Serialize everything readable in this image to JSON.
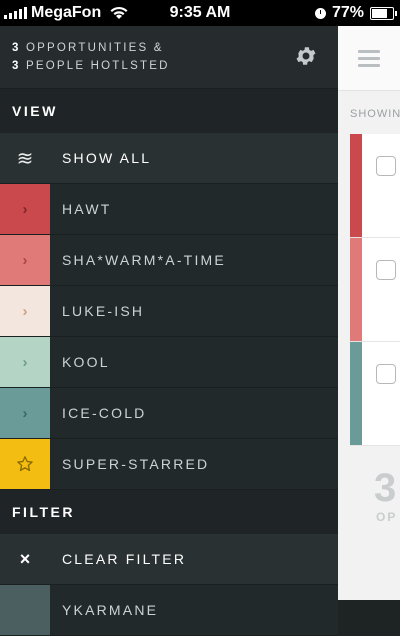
{
  "status_bar": {
    "carrier": "MegaFon",
    "time": "9:35 AM",
    "battery": "77%"
  },
  "sidebar": {
    "summary": {
      "opportunities_count": "3",
      "opportunities_label": "OPPORTUNITIES &",
      "people_count": "3",
      "people_label": "PEOPLE HOTLSTED"
    },
    "view_header": "VIEW",
    "show_all_label": "SHOW ALL",
    "view_items": [
      {
        "label": "HAWT",
        "color": "#c9494c",
        "chevron_color": "#7e2628",
        "icon": "chevron-right-icon"
      },
      {
        "label": "SHA*WARM*A-TIME",
        "color": "#e07a78",
        "chevron_color": "#a64745",
        "icon": "chevron-right-icon"
      },
      {
        "label": "LUKE-ISH",
        "color": "#f3e6de",
        "chevron_color": "#d0a07e",
        "icon": "chevron-right-icon"
      },
      {
        "label": "KOOL",
        "color": "#b4d5c6",
        "chevron_color": "#6f9c88",
        "icon": "chevron-right-icon"
      },
      {
        "label": "ICE-COLD",
        "color": "#6a9b98",
        "chevron_color": "#3f6765",
        "icon": "chevron-right-icon"
      },
      {
        "label": "SUPER-STARRED",
        "color": "#f3be11",
        "chevron_color": "#8a6a00",
        "icon": "star-icon"
      }
    ],
    "filter_header": "FILTER",
    "clear_filter_label": "CLEAR FILTER",
    "partial_item_label": "YKARMANE",
    "partial_item_color": "#4b5f61"
  },
  "main": {
    "showing_label": "SHOWIN",
    "card_colors": [
      "#c9494c",
      "#e07a78",
      "#6a9b98"
    ],
    "big_number": "3",
    "big_number_sub": "OP"
  }
}
